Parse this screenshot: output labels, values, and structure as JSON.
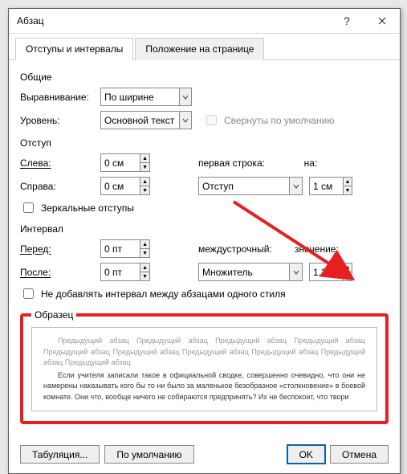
{
  "title": "Абзац",
  "tabs": [
    "Отступы и интервалы",
    "Положение на странице"
  ],
  "general": {
    "label": "Общие",
    "alignment_label": "Выравнивание:",
    "alignment_value": "По ширине",
    "level_label": "Уровень:",
    "level_value": "Основной текст",
    "collapsed_label": "Свернуты по умолчанию"
  },
  "indent": {
    "label": "Отступ",
    "left_label": "Слева:",
    "left_value": "0 см",
    "right_label": "Справа:",
    "right_value": "0 см",
    "firstline_label": "первая строка:",
    "firstline_value": "Отступ",
    "by_label": "на:",
    "by_value": "1 см",
    "mirror_label": "Зеркальные отступы"
  },
  "spacing": {
    "label": "Интервал",
    "before_label": "Перед:",
    "before_value": "0 пт",
    "after_label": "После:",
    "after_value": "0 пт",
    "line_label": "междустрочный:",
    "line_value": "Множитель",
    "at_label": "значение:",
    "at_value": "1,25",
    "nosame_label": "Не добавлять интервал между абзацами одного стиля"
  },
  "preview": {
    "label": "Образец",
    "ghost": "Предыдущий абзац Предыдущий абзац Предыдущий абзац Предыдущий абзац Предыдущий абзац Предыдущий абзац Предыдущий абзац Предыдущий абзац Предыдущий абзац Предыдущий абзац",
    "sample": "Если учителя записали такое в официальной сводке, совершенно очевидно, что они не намерены наказывать кого бы то ни было за маленькое безобразное «столкновение» в боевой комнате. Они что, вообще ничего не собираются предпринять? Их не беспокоит, что твори"
  },
  "footer": {
    "tabs": "Табуляция...",
    "default": "По умолчанию",
    "ok": "OK",
    "cancel": "Отмена"
  }
}
